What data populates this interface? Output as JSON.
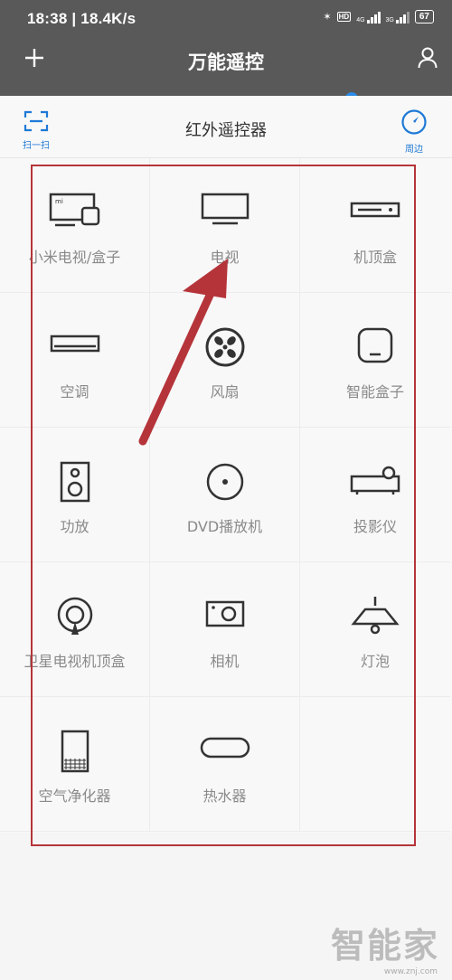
{
  "status": {
    "time": "18:38",
    "speed": "18.4K/s",
    "battery": "67",
    "net1": "4G",
    "net2": "3G",
    "hd": "HD"
  },
  "appbar": {
    "title": "万能遥控"
  },
  "subbar": {
    "title": "红外遥控器",
    "scan_label": "扫一扫",
    "nearby_label": "周边"
  },
  "devices": [
    {
      "label": "小米电视/盒子",
      "icon": "mi-tv-box-icon"
    },
    {
      "label": "电视",
      "icon": "tv-icon"
    },
    {
      "label": "机顶盒",
      "icon": "set-top-box-icon"
    },
    {
      "label": "空调",
      "icon": "air-conditioner-icon"
    },
    {
      "label": "风扇",
      "icon": "fan-icon"
    },
    {
      "label": "智能盒子",
      "icon": "smart-box-icon"
    },
    {
      "label": "功放",
      "icon": "amplifier-icon"
    },
    {
      "label": "DVD播放机",
      "icon": "dvd-icon"
    },
    {
      "label": "投影仪",
      "icon": "projector-icon"
    },
    {
      "label": "卫星电视机顶盒",
      "icon": "satellite-icon"
    },
    {
      "label": "相机",
      "icon": "camera-icon"
    },
    {
      "label": "灯泡",
      "icon": "lamp-icon"
    },
    {
      "label": "空气净化器",
      "icon": "air-purifier-icon"
    },
    {
      "label": "热水器",
      "icon": "water-heater-icon"
    }
  ],
  "colors": {
    "header": "#595959",
    "accent": "#1e79d6",
    "annotation": "#b5343a"
  },
  "watermark": {
    "text": "智能家",
    "site": "www.znj.com"
  }
}
